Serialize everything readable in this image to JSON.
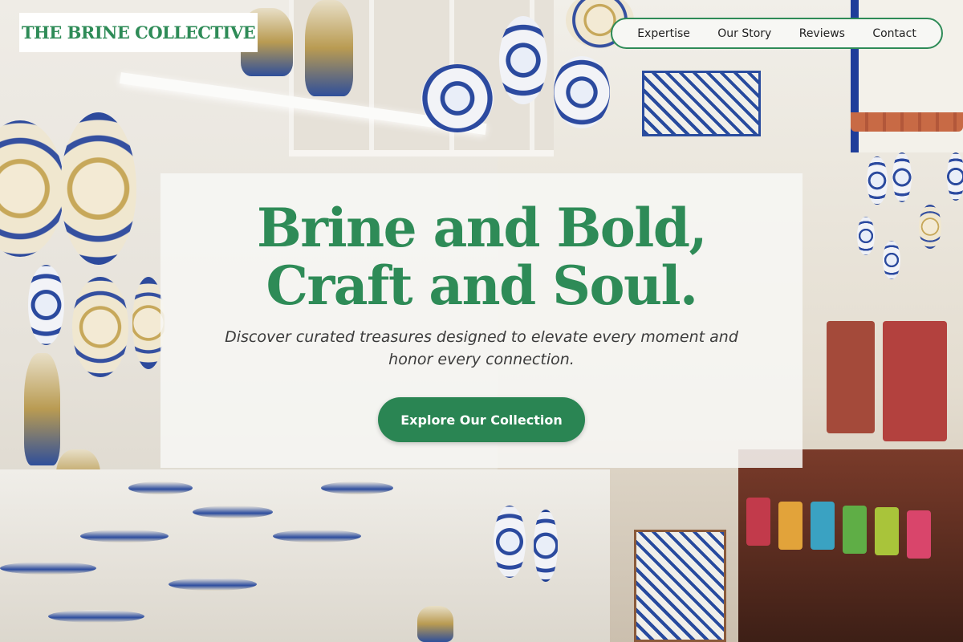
{
  "brand": {
    "logo_text": "THE BRINE COLLECTIVE"
  },
  "nav": {
    "items": [
      {
        "label": "Expertise"
      },
      {
        "label": "Our Story"
      },
      {
        "label": "Reviews"
      },
      {
        "label": "Contact"
      }
    ]
  },
  "hero": {
    "headline": "Brine and Bold, Craft and Soul.",
    "subtitle": "Discover curated treasures designed to elevate every moment and honor every connection.",
    "cta_label": "Explore Our Collection",
    "background_image": "pottery shop interior with hand-painted ceramic plates, bowls and tiles"
  },
  "colors": {
    "brand_green": "#2e8b57",
    "button_green": "#2a8553",
    "nav_background": "#f7f7f4",
    "card_background": "#f7f7f5"
  }
}
